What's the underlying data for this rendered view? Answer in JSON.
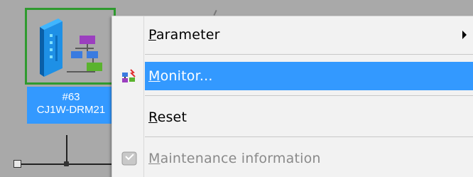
{
  "device": {
    "node_number": "#63",
    "model": "CJ1W-DRM21",
    "icon": "network-module-icon"
  },
  "context_menu": {
    "items": [
      {
        "label_underline": "P",
        "label_rest": "arameter",
        "has_submenu": true,
        "enabled": true,
        "highlighted": false,
        "icon": ""
      },
      {
        "label_underline": "M",
        "label_rest": "onitor...",
        "has_submenu": false,
        "enabled": true,
        "highlighted": true,
        "icon": "monitor-icon"
      },
      {
        "label_underline": "R",
        "label_rest": "eset",
        "has_submenu": false,
        "enabled": true,
        "highlighted": false,
        "icon": ""
      },
      {
        "label_underline": "M",
        "label_rest": "aintenance information",
        "has_submenu": false,
        "enabled": false,
        "highlighted": false,
        "icon": "maintenance-icon"
      }
    ]
  },
  "colors": {
    "highlight": "#3399ff",
    "selection_border": "#2f9a2f",
    "menu_background": "#f2f2f2"
  }
}
